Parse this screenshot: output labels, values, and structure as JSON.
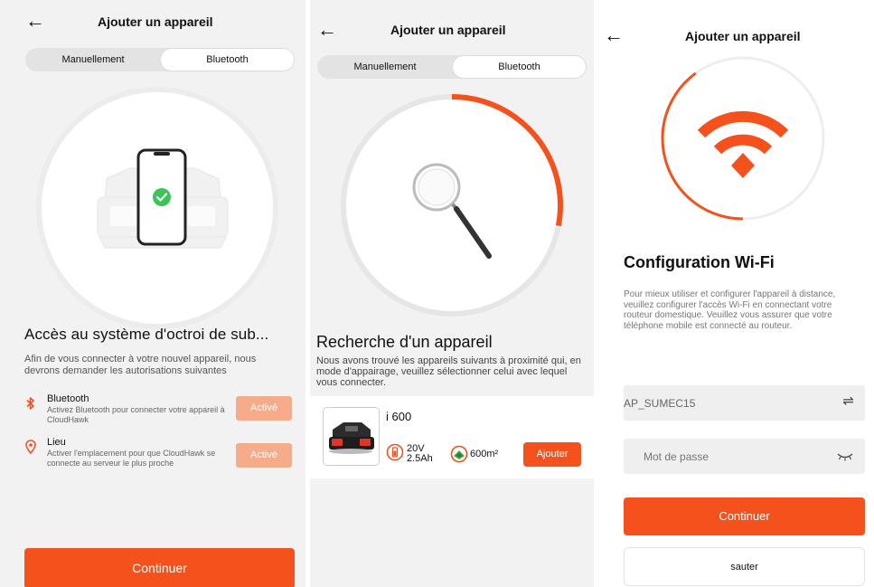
{
  "screen1": {
    "title": "Ajouter un appareil",
    "tabs": [
      {
        "label": "Manuellement"
      },
      {
        "label": "Bluetooth"
      }
    ],
    "heading": "Accès au système d'octroi de sub...",
    "subtitle": "Afin de vous connecter à votre nouvel appareil, nous devrons demander les autorisations suivantes",
    "permissions": [
      {
        "icon": "bluetooth-icon",
        "title": "Bluetooth",
        "description": "Activez Bluetooth pour connecter votre appareil à CloudHawk",
        "button": "Activé"
      },
      {
        "icon": "location-pin-icon",
        "title": "Lieu",
        "description": "Activer l'emplacement pour que CloudHawk se connecte au serveur le plus proche",
        "button": "Activé"
      }
    ],
    "continue_label": "Continuer"
  },
  "screen2": {
    "title": "Ajouter un appareil",
    "tabs": [
      {
        "label": "Manuellement"
      },
      {
        "label": "Bluetooth"
      }
    ],
    "search_progress": 0.28,
    "heading": "Recherche d'un appareil",
    "subtitle": "Nous avons trouvé les appareils suivants à proximité qui, en mode d'appairage, veuillez sélectionner celui avec lequel vous connecter.",
    "device": {
      "name": "i 600",
      "battery_voltage": "20V",
      "battery_capacity": "2.5Ah",
      "area": "600m²",
      "add_label": "Ajouter"
    }
  },
  "screen3": {
    "title": "Ajouter un appareil",
    "wifi_progress": 0.4,
    "heading": "Configuration Wi-Fi",
    "subtitle": "Pour mieux utiliser et configurer l'appareil à distance, veuillez configurer l'accès Wi-Fi en connectant votre routeur domestique. Veuillez vous assurer que votre téléphone mobile est connecté au routeur.",
    "ssid_value": "AP_SUMEC15",
    "password_placeholder": "Mot de passe",
    "continue_label": "Continuer",
    "skip_label": "sauter"
  },
  "colors": {
    "accent": "#f5511c",
    "accent_light": "#f6ab8a",
    "success": "#3cc45a",
    "background": "#f2f2f2"
  }
}
